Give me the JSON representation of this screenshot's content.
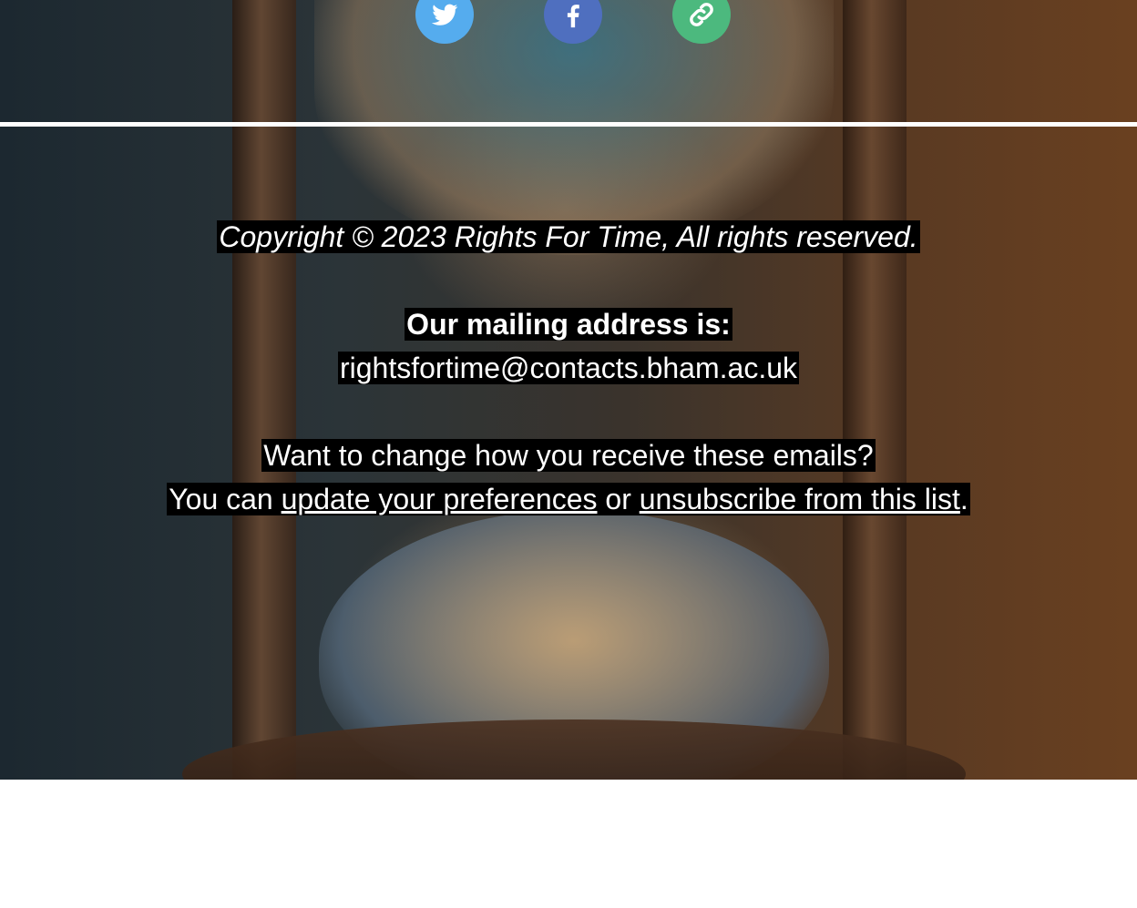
{
  "social": {
    "items": [
      {
        "icon": "twitter-icon",
        "color": "#55acee"
      },
      {
        "icon": "facebook-icon",
        "color": "#4f6fbf"
      },
      {
        "icon": "link-icon",
        "color": "#4cb97e"
      }
    ]
  },
  "footer": {
    "copyright": "Copyright © 2023 Rights For Time, All rights reserved.",
    "mailing_heading": "Our mailing address is:",
    "mailing_email": "rightsfortime@contacts.bham.ac.uk",
    "change_question": "Want to change how you receive these emails?",
    "you_can": "You can ",
    "update_link": "update your preferences",
    "or_text": " or ",
    "unsubscribe_link": "unsubscribe from this list",
    "period": "."
  }
}
